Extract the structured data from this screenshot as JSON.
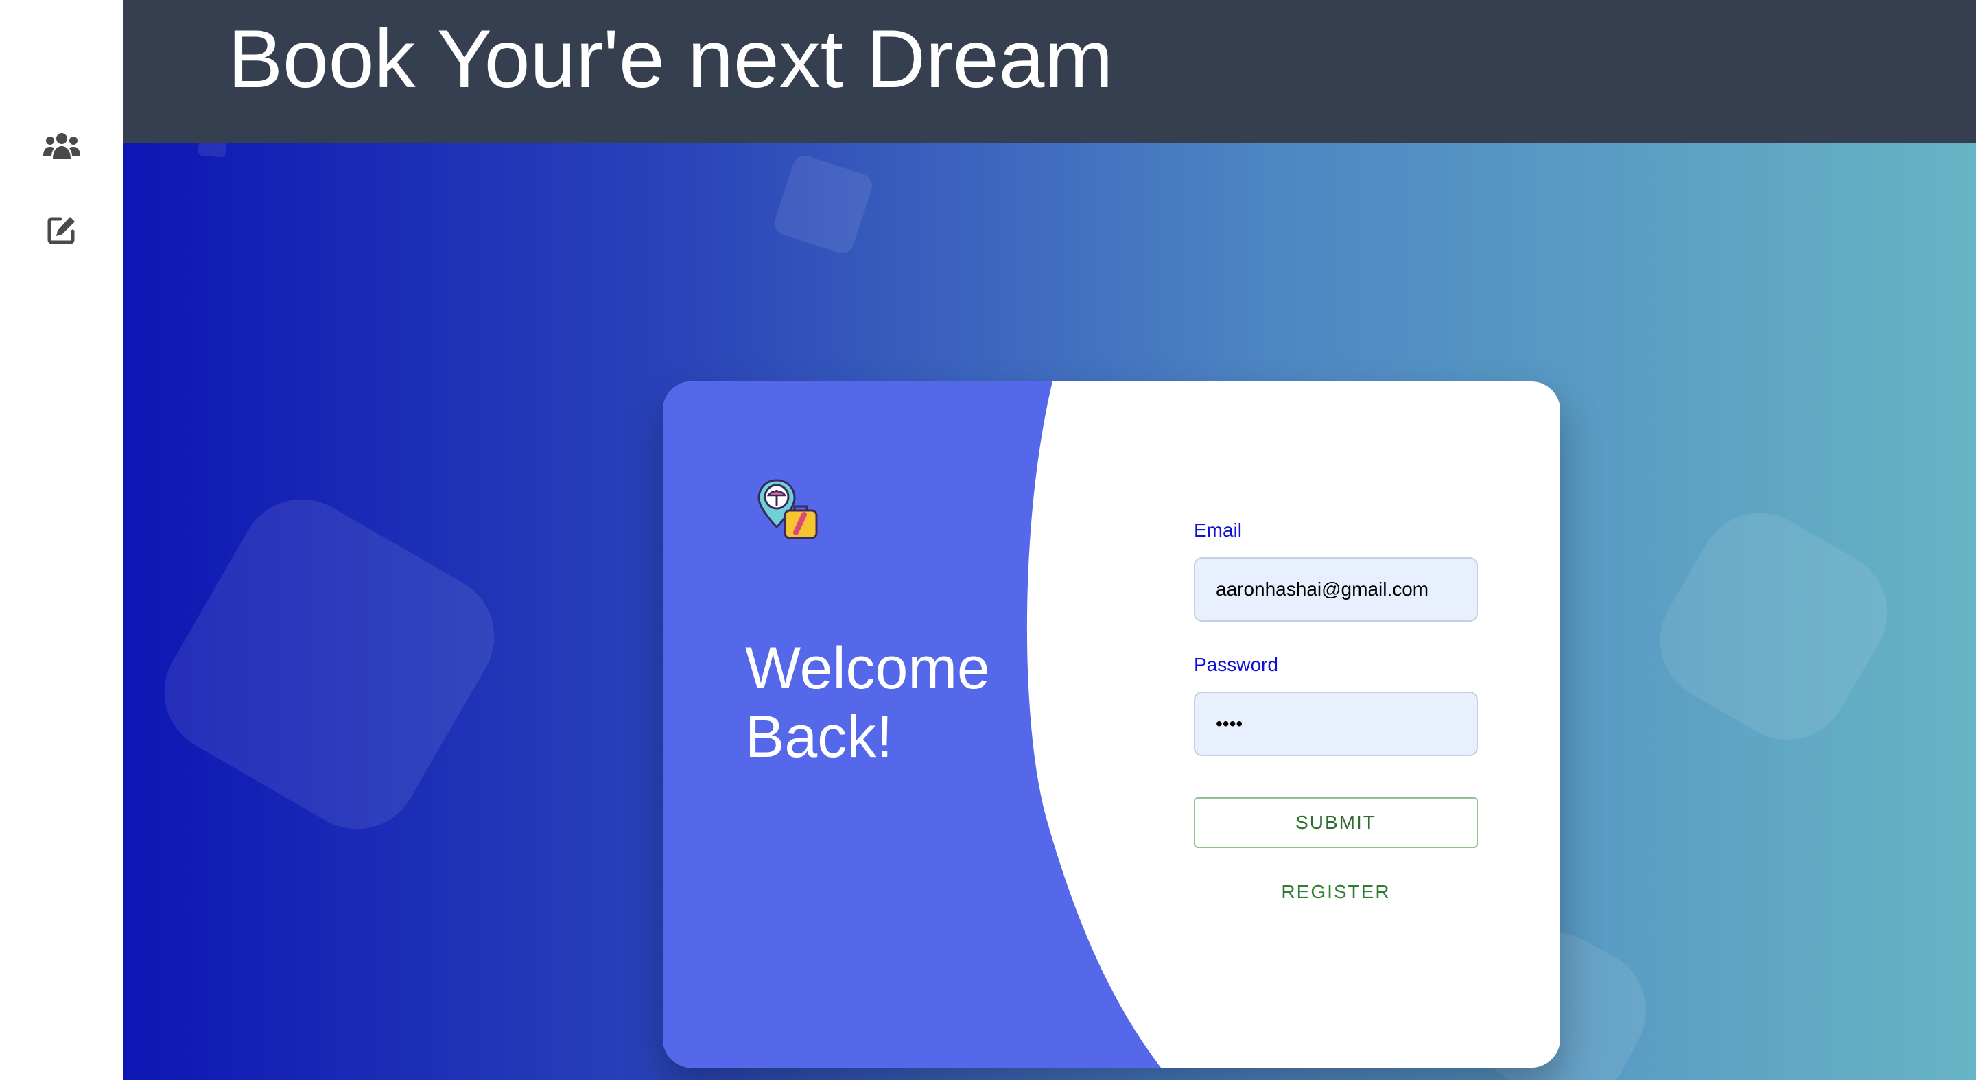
{
  "app": {
    "title": "Book Your'e next Dream"
  },
  "sidebar": {
    "items": [
      {
        "icon": "users-icon"
      },
      {
        "icon": "edit-icon"
      }
    ]
  },
  "card": {
    "welcome_line1": "Welcome",
    "welcome_line2": "Back!",
    "logo_icon": "travel-location-luggage-icon"
  },
  "form": {
    "email_label": "Email",
    "email_value": "aaronhashai@gmail.com",
    "password_label": "Password",
    "password_value": "1234",
    "submit_label": "SUBMIT",
    "register_label": "REGISTER"
  },
  "colors": {
    "header_bg": "#363f4f",
    "card_accent": "#5568ea",
    "label_blue": "#1010d8",
    "button_green": "#2f6d2f",
    "input_bg": "#e8f0fe"
  }
}
